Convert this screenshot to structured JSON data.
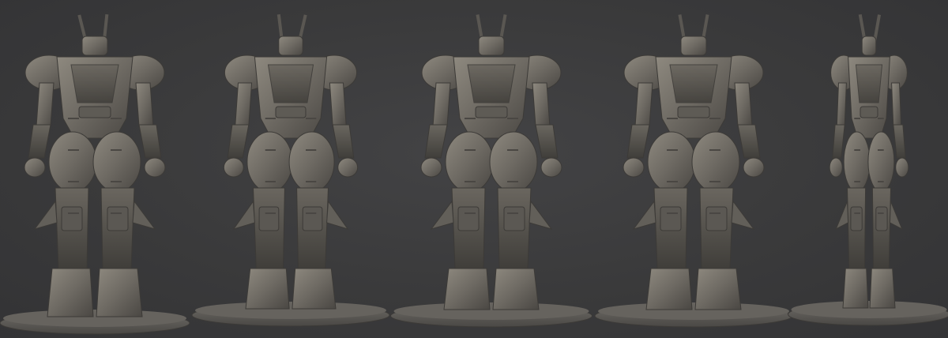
{
  "scene": {
    "background_color": "#3a3a3b",
    "model_color": "#6e6a63",
    "model_highlight": "#8e897f",
    "model_shadow": "#4a4743",
    "base_color": "#5c5a56",
    "views": [
      {
        "view": "back-three-quarter-left"
      },
      {
        "view": "front-three-quarter-left"
      },
      {
        "view": "front"
      },
      {
        "view": "back"
      },
      {
        "view": "side-right"
      }
    ]
  }
}
